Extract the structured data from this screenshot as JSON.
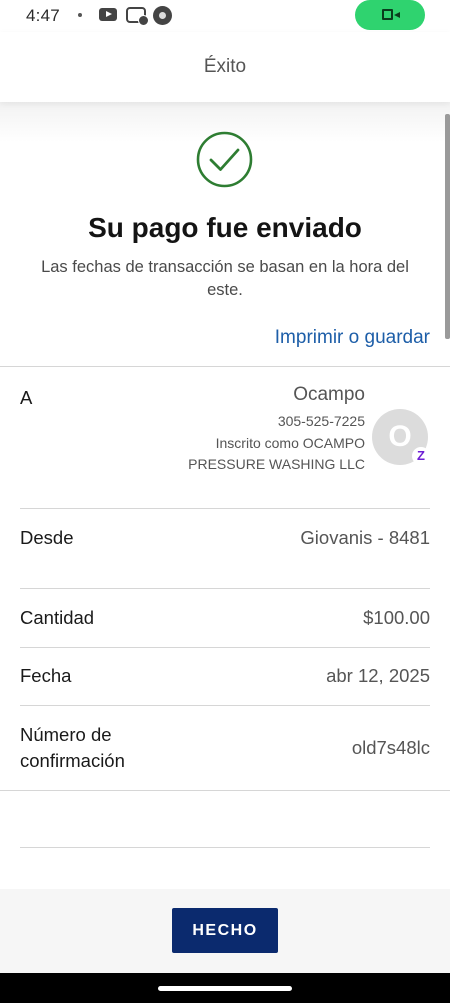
{
  "status_bar": {
    "time": "4:47",
    "icons": [
      "dot",
      "youtube-icon",
      "messenger-icon",
      "app-circle-icon"
    ],
    "call_pill_color": "#2fd36f",
    "call_icon": "video-camera-icon"
  },
  "header": {
    "title": "Éxito"
  },
  "confirmation": {
    "icon": "check-circle-icon",
    "icon_color": "#2e7d32",
    "title": "Su pago fue enviado",
    "subtitle": "Las fechas de transacción se basan en la hora del este.",
    "print_link": "Imprimir o guardar",
    "link_color": "#1d5ea8"
  },
  "details": {
    "to": {
      "label": "A",
      "name": "Ocampo",
      "phone": "305-525-7225",
      "enrolled": "Inscrito como OCAMPO PRESSURE WASHING LLC",
      "avatar_letter": "O",
      "badge_icon": "zelle-icon",
      "badge_text": "Z"
    },
    "from": {
      "label": "Desde",
      "value": "Giovanis - 8481"
    },
    "amount": {
      "label": "Cantidad",
      "value": "$100.00"
    },
    "date": {
      "label": "Fecha",
      "value": "abr 12, 2025"
    },
    "confirmation_number": {
      "label": "Número de confirmación",
      "value": "old7s48lc"
    }
  },
  "footer": {
    "done_label": "HECHO",
    "button_color": "#0b2a6e"
  }
}
